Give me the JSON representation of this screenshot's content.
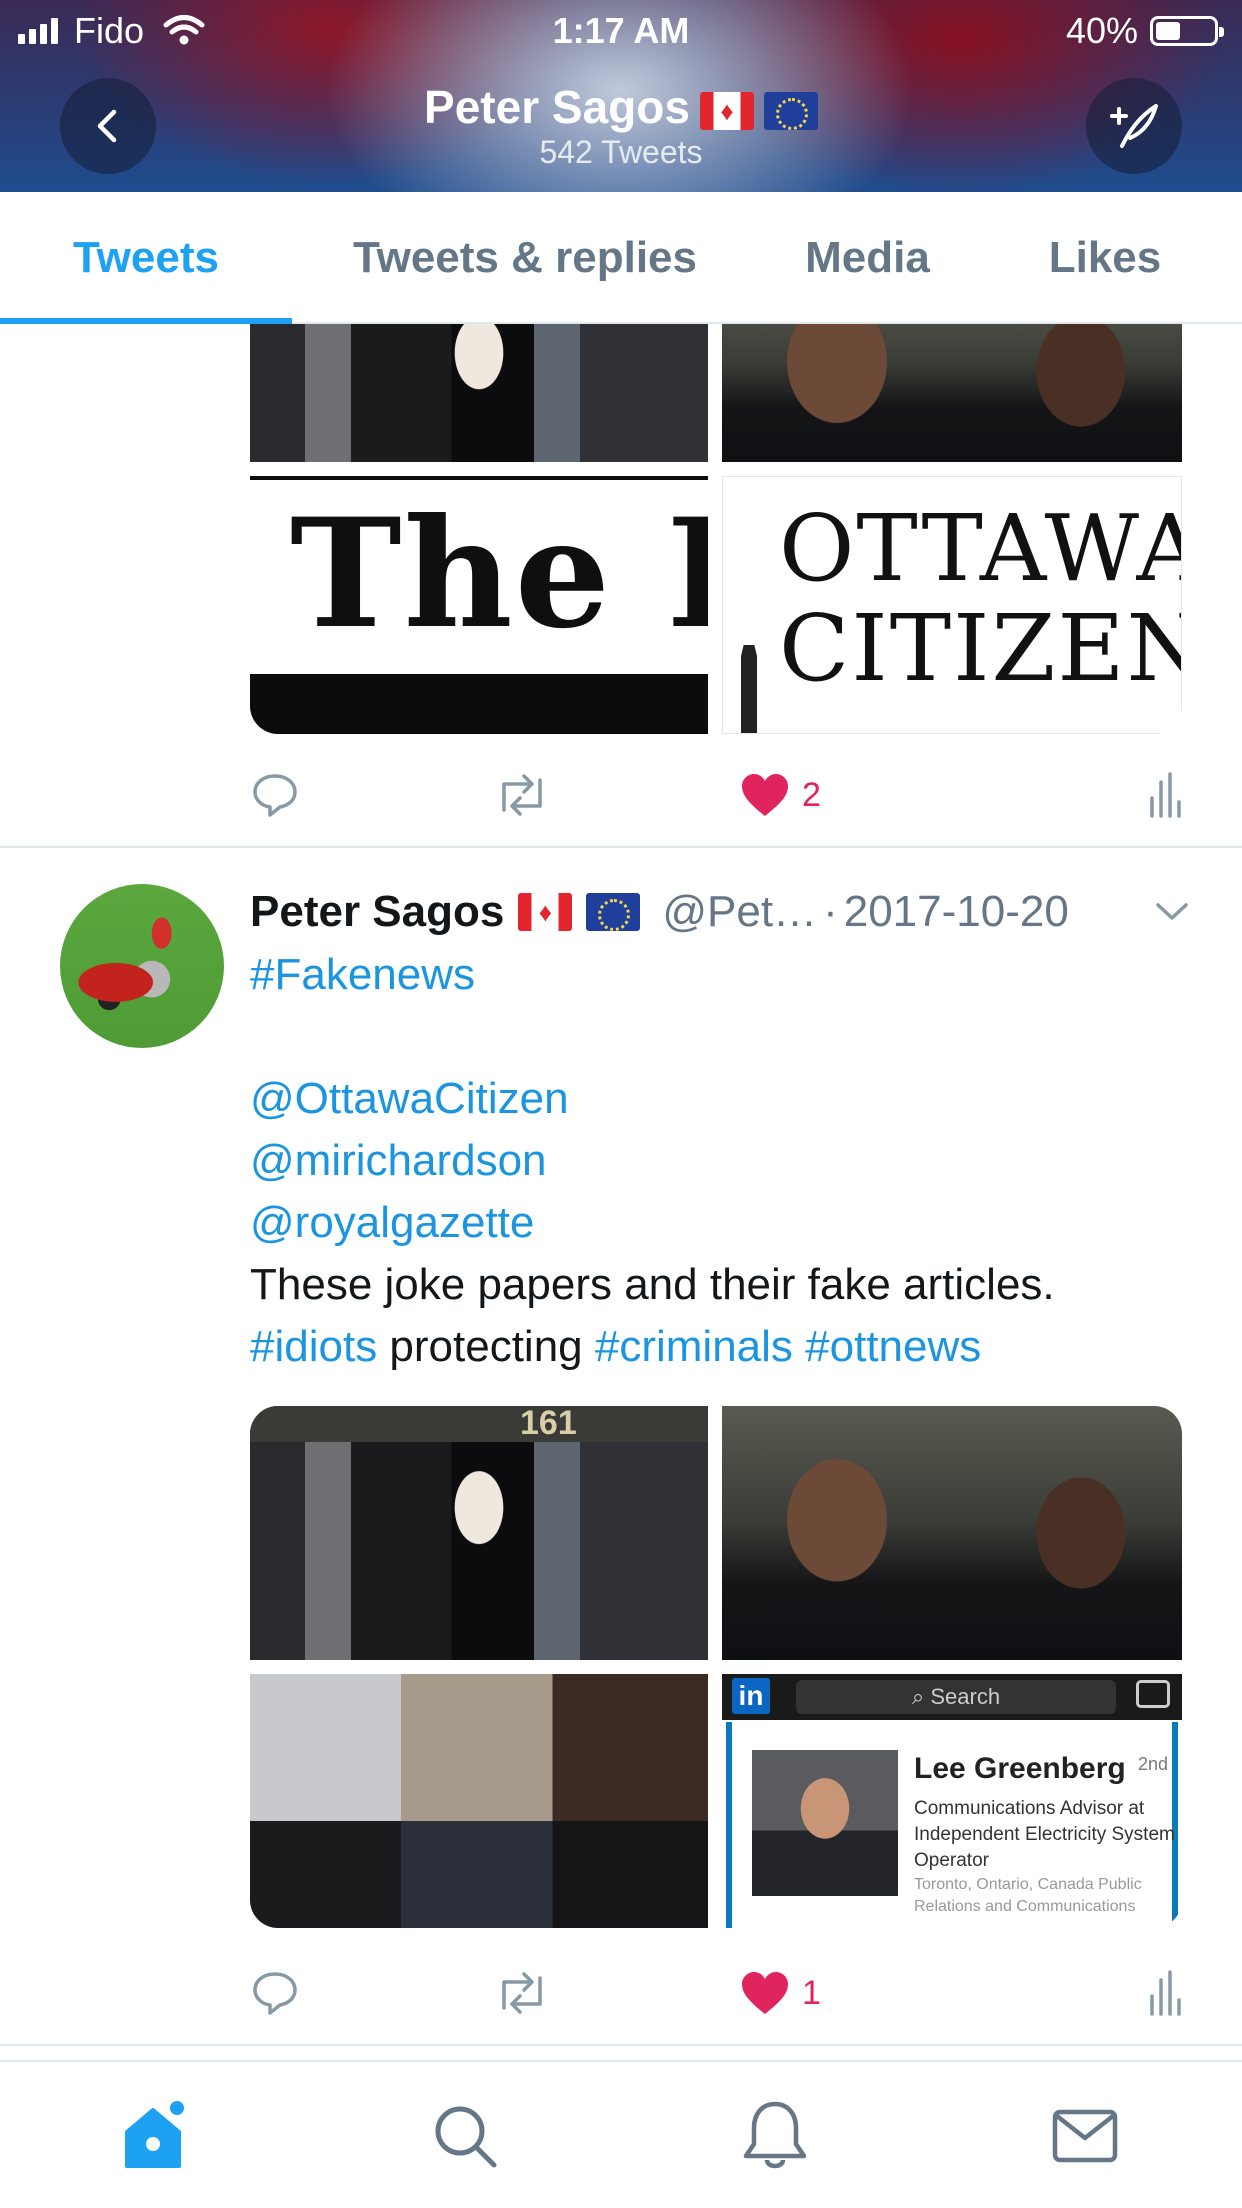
{
  "status_bar": {
    "carrier": "Fido",
    "time": "1:17 AM",
    "battery_percent": "40%",
    "battery_level": 0.4,
    "icons": [
      "signal-icon",
      "wifi-icon",
      "battery-icon"
    ]
  },
  "header": {
    "name": "Peter Sagos",
    "name_flags": [
      "canada-flag",
      "eu-flag"
    ],
    "tweet_count": "542 Tweets",
    "back_icon": "chevron-left-icon",
    "compose_icon": "compose-tweet-icon"
  },
  "tabs": [
    {
      "label": "Tweets",
      "active": true
    },
    {
      "label": "Tweets & replies",
      "active": false
    },
    {
      "label": "Media",
      "active": false
    },
    {
      "label": "Likes",
      "active": false
    }
  ],
  "tweets": [
    {
      "media": {
        "top_left": "photo-crowd-lawyer",
        "top_right": "photo-couple",
        "bottom_left": {
          "masthead_text": "The R"
        },
        "bottom_right": {
          "masthead_text": "OTTAWA\nCITIZEN"
        }
      },
      "likes": "2"
    },
    {
      "author": "Peter Sagos",
      "author_flags": [
        "canada-flag",
        "eu-flag"
      ],
      "handle": "@Pet…",
      "date_sep": "·",
      "date": "2017-10-20",
      "body": {
        "line1": "#Fakenews",
        "line2": "@OttawaCitizen",
        "line3": "@mirichardson",
        "line4": "@royalgazette",
        "line5": "These joke papers and their fake articles.",
        "line6_tag1": "#idiots",
        "line6_text": " protecting ",
        "line6_tag2": "#criminals",
        "line6_tag3": "#ottnews"
      },
      "media": {
        "top_left": {
          "overlay_number": "161"
        },
        "top_right": "photo-couple",
        "bottom_left": "photo-three-lawyers",
        "bottom_right": {
          "logo": "in",
          "search_placeholder": "Search",
          "name": "Lee Greenberg",
          "degree": "2nd",
          "title": "Communications Advisor at Independent Electricity System Operator",
          "location": "Toronto, Ontario, Canada Public Relations and Communications"
        }
      },
      "likes": "1"
    }
  ],
  "bottom_nav": [
    {
      "icon": "home-icon",
      "active": true
    },
    {
      "icon": "search-icon",
      "active": false
    },
    {
      "icon": "notifications-icon",
      "active": false
    },
    {
      "icon": "messages-icon",
      "active": false
    }
  ],
  "colors": {
    "accent": "#1da1f2",
    "link": "#1b95e0",
    "like": "#e0245e",
    "muted": "#657786"
  }
}
